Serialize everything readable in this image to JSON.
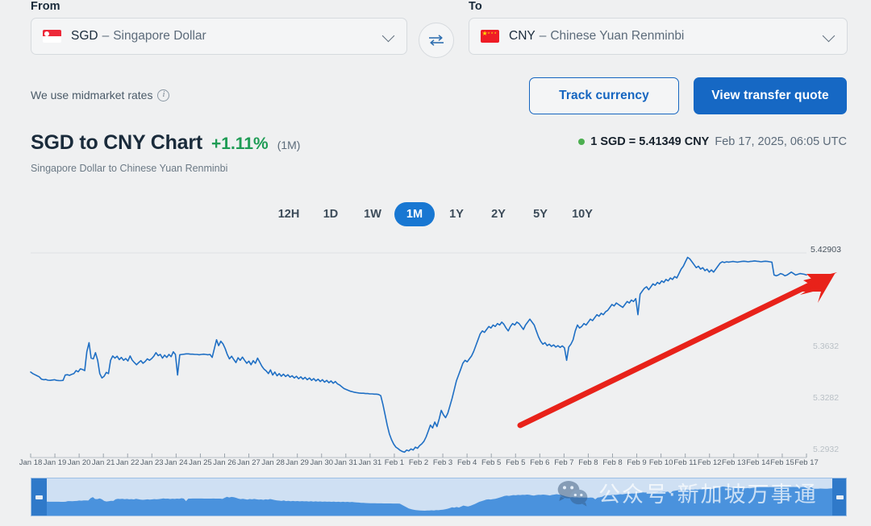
{
  "converter": {
    "from": {
      "label": "From",
      "code": "SGD",
      "separator": "–",
      "name": "Singapore Dollar",
      "flag": "singapore-flag-icon"
    },
    "to": {
      "label": "To",
      "code": "CNY",
      "separator": "–",
      "name": "Chinese Yuan Renminbi",
      "flag": "china-flag-icon"
    },
    "swap_icon": "swap-arrows-icon"
  },
  "midmarket": {
    "text": "We use midmarket rates",
    "info_icon": "info-icon"
  },
  "actions": {
    "track_label": "Track currency",
    "quote_label": "View transfer quote"
  },
  "chart_header": {
    "title": "SGD to CNY Chart",
    "percent_change": "+1.11%",
    "period": "(1M)",
    "subtitle": "Singapore Dollar to Chinese Yuan Renminbi",
    "rate_text": "1 SGD = 5.41349 CNY",
    "timestamp": "Feb 17, 2025, 06:05 UTC",
    "status_dot_color": "#4caf50",
    "positive_color": "#1f9c55"
  },
  "range_tabs": {
    "items": [
      "12H",
      "1D",
      "1W",
      "1M",
      "1Y",
      "2Y",
      "5Y",
      "10Y"
    ],
    "active": "1M"
  },
  "watermark": {
    "text": "公众号·新加坡万事通",
    "logo_icon": "wechat-logo-icon"
  },
  "navigator": {
    "left_handle": "navigator-left-handle",
    "right_handle": "navigator-right-handle"
  },
  "annotation": {
    "arrow": "red-trend-arrow"
  },
  "chart_data": {
    "type": "line",
    "title": "SGD to CNY Chart",
    "subtitle": "Singapore Dollar to Chinese Yuan Renminbi",
    "xlabel": "",
    "ylabel": "",
    "grid": false,
    "legend": "none",
    "line_color": "#1f6fc4",
    "ylim": [
      5.2932,
      5.42903
    ],
    "yticks": [
      5.42903,
      5.3632,
      5.3282,
      5.2932
    ],
    "ytick_labels": [
      "5.42903",
      "5.3632",
      "5.3282",
      "5.2932"
    ],
    "xticks": [
      "Jan 18",
      "Jan 19",
      "Jan 20",
      "Jan 21",
      "Jan 22",
      "Jan 23",
      "Jan 24",
      "Jan 25",
      "Jan 26",
      "Jan 27",
      "Jan 28",
      "Jan 29",
      "Jan 30",
      "Jan 31",
      "Jan 31",
      "Feb 1",
      "Feb 2",
      "Feb 3",
      "Feb 4",
      "Feb 5",
      "Feb 5",
      "Feb 6",
      "Feb 7",
      "Feb 8",
      "Feb 8",
      "Feb 9",
      "Feb 10",
      "Feb 11",
      "Feb 12",
      "Feb 13",
      "Feb 14",
      "Feb 15",
      "Feb 17"
    ],
    "x_start": "Jan 18",
    "x_end": "Feb 17",
    "values": [
      5.348,
      5.347,
      5.3462,
      5.3455,
      5.3448,
      5.3432,
      5.3428,
      5.343,
      5.3425,
      5.3424,
      5.3426,
      5.3428,
      5.3424,
      5.3423,
      5.3422,
      5.3424,
      5.346,
      5.3462,
      5.3458,
      5.3465,
      5.347,
      5.349,
      5.3482,
      5.3502,
      5.3498,
      5.349,
      5.362,
      5.368,
      5.3575,
      5.357,
      5.3612,
      5.356,
      5.347,
      5.344,
      5.3452,
      5.3478,
      5.347,
      5.356,
      5.359,
      5.3575,
      5.3588,
      5.3565,
      5.358,
      5.356,
      5.3572,
      5.3556,
      5.359,
      5.3562,
      5.3545,
      5.353,
      5.3545,
      5.3558,
      5.354,
      5.3552,
      5.357,
      5.356,
      5.3572,
      5.3588,
      5.3612,
      5.3592,
      5.36,
      5.3575,
      5.3595,
      5.358,
      5.36,
      5.3585,
      5.3618,
      5.36,
      5.346,
      5.3598,
      5.36,
      5.3602,
      5.3604,
      5.3604,
      5.3602,
      5.3602,
      5.36,
      5.36,
      5.3598,
      5.36,
      5.3602,
      5.36,
      5.3598,
      5.36,
      5.358,
      5.364,
      5.37,
      5.366,
      5.369,
      5.3672,
      5.364,
      5.36,
      5.357,
      5.3588,
      5.3565,
      5.3545,
      5.3578,
      5.356,
      5.3582,
      5.356,
      5.354,
      5.3555,
      5.353,
      5.3558,
      5.354,
      5.3575,
      5.3548,
      5.352,
      5.35,
      5.3488,
      5.347,
      5.3495,
      5.346,
      5.348,
      5.3455,
      5.347,
      5.3452,
      5.3466,
      5.345,
      5.3462,
      5.3446,
      5.3455,
      5.344,
      5.3452,
      5.3435,
      5.3448,
      5.3432,
      5.3444,
      5.3428,
      5.344,
      5.3424,
      5.3436,
      5.342,
      5.3432,
      5.3416,
      5.3428,
      5.3412,
      5.3424,
      5.3408,
      5.342,
      5.3404,
      5.3416,
      5.34,
      5.3392,
      5.338,
      5.3368,
      5.3362,
      5.3356,
      5.335,
      5.3346,
      5.3342,
      5.334,
      5.3338,
      5.3336,
      5.3336,
      5.3334,
      5.3334,
      5.3332,
      5.3332,
      5.333,
      5.333,
      5.3328,
      5.332,
      5.326,
      5.319,
      5.312,
      5.306,
      5.302,
      5.299,
      5.297,
      5.296,
      5.2948,
      5.294,
      5.2936,
      5.295,
      5.2944,
      5.2958,
      5.295,
      5.297,
      5.2962,
      5.298,
      5.2992,
      5.301,
      5.304,
      5.308,
      5.312,
      5.31,
      5.314,
      5.311,
      5.316,
      5.322,
      5.319,
      5.317,
      5.32,
      5.325,
      5.33,
      5.336,
      5.342,
      5.346,
      5.35,
      5.354,
      5.356,
      5.355,
      5.357,
      5.359,
      5.362,
      5.366,
      5.37,
      5.374,
      5.376,
      5.375,
      5.377,
      5.379,
      5.378,
      5.38,
      5.379,
      5.381,
      5.38,
      5.382,
      5.3805,
      5.378,
      5.376,
      5.379,
      5.381,
      5.38,
      5.382,
      5.381,
      5.379,
      5.377,
      5.38,
      5.382,
      5.384,
      5.382,
      5.38,
      5.376,
      5.372,
      5.369,
      5.367,
      5.368,
      5.366,
      5.367,
      5.3655,
      5.3665,
      5.365,
      5.366,
      5.3648,
      5.3658,
      5.3645,
      5.356,
      5.365,
      5.367,
      5.37,
      5.376,
      5.38,
      5.378,
      5.379,
      5.381,
      5.38,
      5.382,
      5.384,
      5.383,
      5.385,
      5.387,
      5.386,
      5.388,
      5.387,
      5.389,
      5.39,
      5.392,
      5.394,
      5.393,
      5.395,
      5.394,
      5.393,
      5.392,
      5.394,
      5.396,
      5.395,
      5.397,
      5.396,
      5.398,
      5.387,
      5.401,
      5.403,
      5.405,
      5.406,
      5.404,
      5.406,
      5.408,
      5.407,
      5.409,
      5.408,
      5.41,
      5.409,
      5.411,
      5.41,
      5.412,
      5.411,
      5.413,
      5.412,
      5.415,
      5.418,
      5.42,
      5.423,
      5.426,
      5.425,
      5.423,
      5.421,
      5.419,
      5.42,
      5.418,
      5.419,
      5.417,
      5.418,
      5.416,
      5.4175,
      5.416,
      5.418,
      5.42,
      5.422,
      5.423,
      5.4225,
      5.423,
      5.4228,
      5.423,
      5.4232,
      5.423,
      5.4228,
      5.423,
      5.4232,
      5.4234,
      5.4232,
      5.423,
      5.4232,
      5.4234,
      5.4236,
      5.4234,
      5.4232,
      5.423,
      5.4232,
      5.4234,
      5.4232,
      5.423,
      5.4228,
      5.414,
      5.4135,
      5.414,
      5.415,
      5.4145,
      5.4135,
      5.414,
      5.415,
      5.416,
      5.415,
      5.414,
      5.4145,
      5.415,
      5.4148,
      5.4145,
      5.414
    ]
  }
}
